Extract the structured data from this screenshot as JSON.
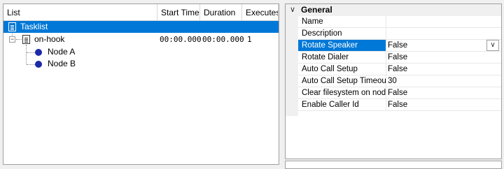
{
  "list": {
    "columns": [
      "List",
      "Start Time",
      "Duration",
      "Executes"
    ],
    "tasklist_label": "Tasklist",
    "task": {
      "name": "on-hook",
      "start_time": "00:00.000",
      "duration": "00:00.000",
      "executes": "1",
      "expander": "−"
    },
    "nodes": [
      "Node A",
      "Node B"
    ]
  },
  "properties": {
    "category": "General",
    "category_chevron": "∨",
    "dropdown_glyph": "∨",
    "rows": [
      {
        "name": "Name",
        "value": ""
      },
      {
        "name": "Description",
        "value": ""
      },
      {
        "name": "Rotate Speaker",
        "value": "False"
      },
      {
        "name": "Rotate Dialer",
        "value": "False"
      },
      {
        "name": "Auto Call Setup",
        "value": "False"
      },
      {
        "name": "Auto Call Setup Timeout",
        "value": "30"
      },
      {
        "name": "Clear filesystem on nodes",
        "value": "False"
      },
      {
        "name": "Enable Caller Id",
        "value": "False"
      }
    ]
  },
  "colors": {
    "selection": "#0078d7",
    "node_dot": "#1c2aa8"
  },
  "icons": [
    "document-icon",
    "node-dot-icon",
    "collapse-icon",
    "chevron-down-icon"
  ]
}
